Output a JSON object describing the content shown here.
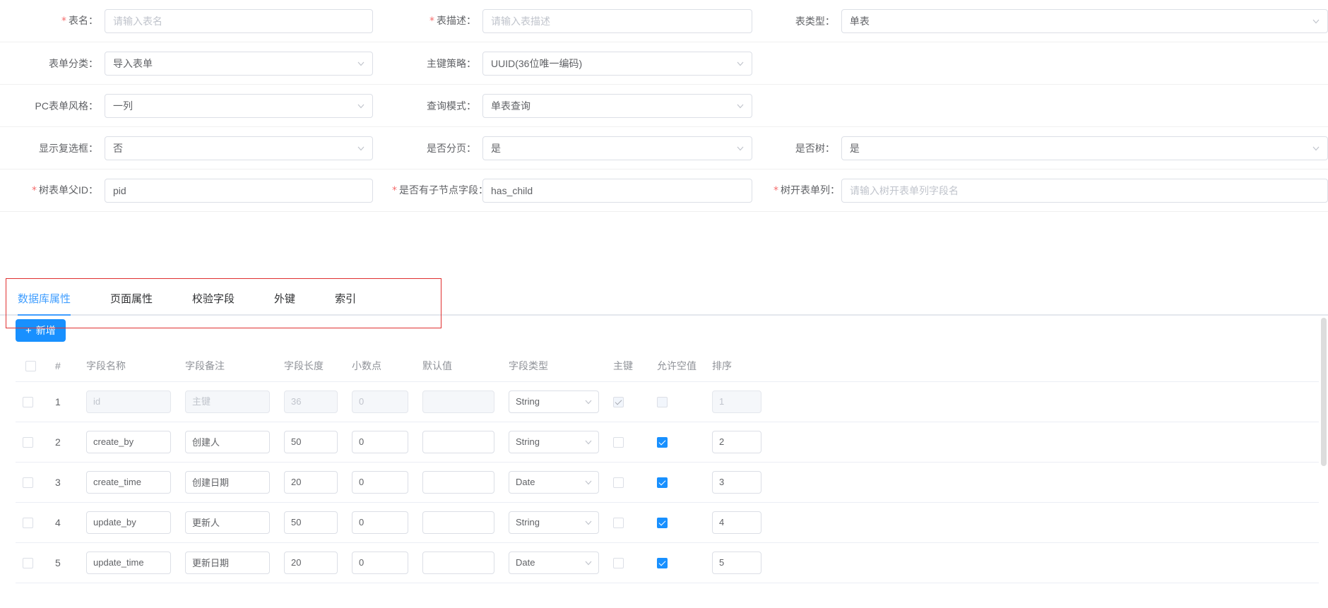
{
  "form": {
    "rows": [
      {
        "cells": [
          {
            "label": "表名：",
            "required": true,
            "type": "input",
            "value": "",
            "placeholder": "请输入表名"
          },
          {
            "label": "表描述：",
            "required": true,
            "type": "input",
            "value": "",
            "placeholder": "请输入表描述"
          },
          {
            "label": "表类型：",
            "required": false,
            "type": "select",
            "value": "单表",
            "placeholder": ""
          }
        ]
      },
      {
        "cells": [
          {
            "label": "表单分类：",
            "required": false,
            "type": "select",
            "value": "导入表单",
            "placeholder": ""
          },
          {
            "label": "主键策略：",
            "required": false,
            "type": "select",
            "value": "UUID(36位唯一编码)",
            "placeholder": ""
          },
          {
            "label": "",
            "required": false,
            "type": "none",
            "value": "",
            "placeholder": ""
          }
        ]
      },
      {
        "cells": [
          {
            "label": "PC表单风格：",
            "required": false,
            "type": "select",
            "value": "一列",
            "placeholder": ""
          },
          {
            "label": "查询模式：",
            "required": false,
            "type": "select",
            "value": "单表查询",
            "placeholder": ""
          },
          {
            "label": "",
            "required": false,
            "type": "none",
            "value": "",
            "placeholder": ""
          }
        ]
      },
      {
        "cells": [
          {
            "label": "显示复选框：",
            "required": false,
            "type": "select",
            "value": "否",
            "placeholder": ""
          },
          {
            "label": "是否分页：",
            "required": false,
            "type": "select",
            "value": "是",
            "placeholder": ""
          },
          {
            "label": "是否树：",
            "required": false,
            "type": "select",
            "value": "是",
            "placeholder": ""
          }
        ]
      },
      {
        "cells": [
          {
            "label": "树表单父ID：",
            "required": true,
            "type": "input",
            "value": "pid",
            "placeholder": ""
          },
          {
            "label": "是否有子节点字段：",
            "required": true,
            "type": "input",
            "value": "has_child",
            "placeholder": ""
          },
          {
            "label": "树开表单列：",
            "required": true,
            "type": "input",
            "value": "",
            "placeholder": "请输入树开表单列字段名"
          }
        ]
      }
    ]
  },
  "tabs": [
    {
      "label": "数据库属性",
      "active": true
    },
    {
      "label": "页面属性",
      "active": false
    },
    {
      "label": "校验字段",
      "active": false
    },
    {
      "label": "外键",
      "active": false
    },
    {
      "label": "索引",
      "active": false
    }
  ],
  "toolbar": {
    "add_label": "新增",
    "add_icon": "plus-icon",
    "add_color": "#1890ff"
  },
  "table": {
    "headers": [
      "",
      "#",
      "字段名称",
      "字段备注",
      "字段长度",
      "小数点",
      "默认值",
      "字段类型",
      "主键",
      "允许空值",
      "排序"
    ],
    "rows": [
      {
        "selected": false,
        "index": "1",
        "disabled": true,
        "name": "id",
        "name_ph": "id",
        "note": "主键",
        "note_ph": "主键",
        "length": "36",
        "length_ph": "36",
        "decimal": "0",
        "decimal_ph": "0",
        "default": "",
        "default_ph": "",
        "type": "String",
        "pk": true,
        "pk_disabled": true,
        "nullable": false,
        "nullable_disabled": true,
        "sort": "1",
        "sort_ph": "1"
      },
      {
        "selected": false,
        "index": "2",
        "disabled": false,
        "name": "create_by",
        "name_ph": "",
        "note": "创建人",
        "note_ph": "",
        "length": "50",
        "length_ph": "",
        "decimal": "0",
        "decimal_ph": "",
        "default": "",
        "default_ph": "",
        "type": "String",
        "pk": false,
        "pk_disabled": false,
        "nullable": true,
        "nullable_disabled": false,
        "sort": "2",
        "sort_ph": ""
      },
      {
        "selected": false,
        "index": "3",
        "disabled": false,
        "name": "create_time",
        "name_ph": "",
        "note": "创建日期",
        "note_ph": "",
        "length": "20",
        "length_ph": "",
        "decimal": "0",
        "decimal_ph": "",
        "default": "",
        "default_ph": "",
        "type": "Date",
        "pk": false,
        "pk_disabled": false,
        "nullable": true,
        "nullable_disabled": false,
        "sort": "3",
        "sort_ph": ""
      },
      {
        "selected": false,
        "index": "4",
        "disabled": false,
        "name": "update_by",
        "name_ph": "",
        "note": "更新人",
        "note_ph": "",
        "length": "50",
        "length_ph": "",
        "decimal": "0",
        "decimal_ph": "",
        "default": "",
        "default_ph": "",
        "type": "String",
        "pk": false,
        "pk_disabled": false,
        "nullable": true,
        "nullable_disabled": false,
        "sort": "4",
        "sort_ph": ""
      },
      {
        "selected": false,
        "index": "5",
        "disabled": false,
        "name": "update_time",
        "name_ph": "",
        "note": "更新日期",
        "note_ph": "",
        "length": "20",
        "length_ph": "",
        "decimal": "0",
        "decimal_ph": "",
        "default": "",
        "default_ph": "",
        "type": "Date",
        "pk": false,
        "pk_disabled": false,
        "nullable": true,
        "nullable_disabled": false,
        "sort": "5",
        "sort_ph": ""
      }
    ]
  }
}
